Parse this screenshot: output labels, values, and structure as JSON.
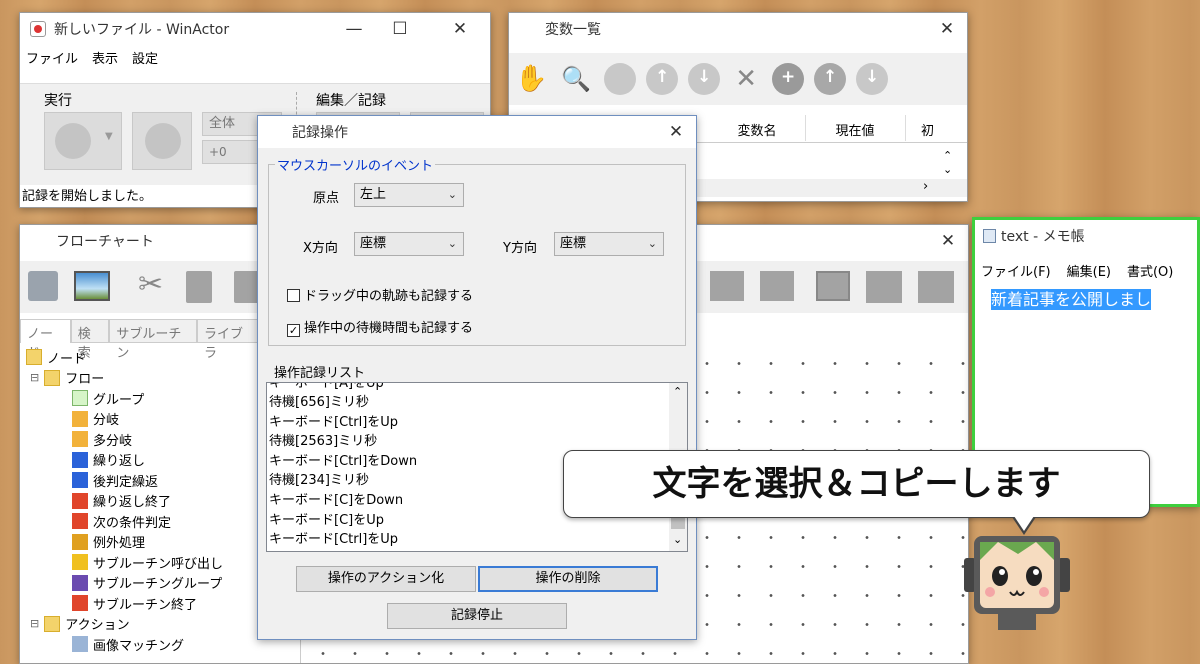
{
  "winactor": {
    "title": "新しいファイル - WinActor",
    "menu": [
      "ファイル",
      "表示",
      "設定"
    ],
    "group_run": "実行",
    "group_edit": "編集／記録",
    "scope_value": "全体",
    "offset_value": "+0",
    "status": "記録を開始しました。"
  },
  "variables": {
    "title": "変数一覧",
    "columns": [
      "変数名",
      "現在値",
      "初"
    ]
  },
  "flowchart": {
    "title": "フローチャート",
    "tabs": [
      "ノード",
      "検索",
      "サブルーチン",
      "ライブラ"
    ],
    "tree": [
      {
        "label": "ノード",
        "level": 0,
        "icon": "folder-icon"
      },
      {
        "label": "フロー",
        "level": 1,
        "icon": "folder-icon"
      },
      {
        "label": "グループ",
        "level": 2,
        "icon": "group-icon"
      },
      {
        "label": "分岐",
        "level": 2,
        "icon": "branch-icon"
      },
      {
        "label": "多分岐",
        "level": 2,
        "icon": "multi-branch-icon"
      },
      {
        "label": "繰り返し",
        "level": 2,
        "icon": "loop-icon"
      },
      {
        "label": "後判定繰返",
        "level": 2,
        "icon": "post-loop-icon"
      },
      {
        "label": "繰り返し終了",
        "level": 2,
        "icon": "loop-end-icon"
      },
      {
        "label": "次の条件判定",
        "level": 2,
        "icon": "next-condition-icon"
      },
      {
        "label": "例外処理",
        "level": 2,
        "icon": "exception-icon"
      },
      {
        "label": "サブルーチン呼び出し",
        "level": 2,
        "icon": "subroutine-call-icon"
      },
      {
        "label": "サブルーチングループ",
        "level": 2,
        "icon": "subroutine-group-icon"
      },
      {
        "label": "サブルーチン終了",
        "level": 2,
        "icon": "subroutine-end-icon"
      },
      {
        "label": "アクション",
        "level": 1,
        "icon": "folder-icon"
      },
      {
        "label": "画像マッチング",
        "level": 2,
        "icon": "image-match-icon"
      }
    ]
  },
  "record_dialog": {
    "title": "記録操作",
    "mouse_group": "マウスカーソルのイベント",
    "origin_label": "原点",
    "origin_value": "左上",
    "x_label": "X方向",
    "x_value": "座標",
    "y_label": "Y方向",
    "y_value": "座標",
    "check_drag": "ドラッグ中の軌跡も記録する",
    "check_wait": "操作中の待機時間も記録する",
    "check_drag_checked": false,
    "check_wait_checked": true,
    "list_label": "操作記録リスト",
    "list_partial": "キーボード[A]をUp",
    "list_items": [
      "待機[656]ミリ秒",
      "キーボード[Ctrl]をUp",
      "待機[2563]ミリ秒",
      "キーボード[Ctrl]をDown",
      "待機[234]ミリ秒",
      "キーボード[C]をDown",
      "キーボード[C]をUp",
      "キーボード[Ctrl]をUp"
    ],
    "btn_action": "操作のアクション化",
    "btn_delete": "操作の削除",
    "btn_stop": "記録停止"
  },
  "notepad": {
    "title": "text - メモ帳",
    "menu": [
      "ファイル(F)",
      "編集(E)",
      "書式(O)"
    ],
    "content": "新着記事を公開しまし"
  },
  "caption": "文字を選択＆コピーします",
  "colors": {
    "selection": "#3399ff",
    "groupbox_title": "#0033cc",
    "notepad_frame": "#3ecf3e"
  }
}
